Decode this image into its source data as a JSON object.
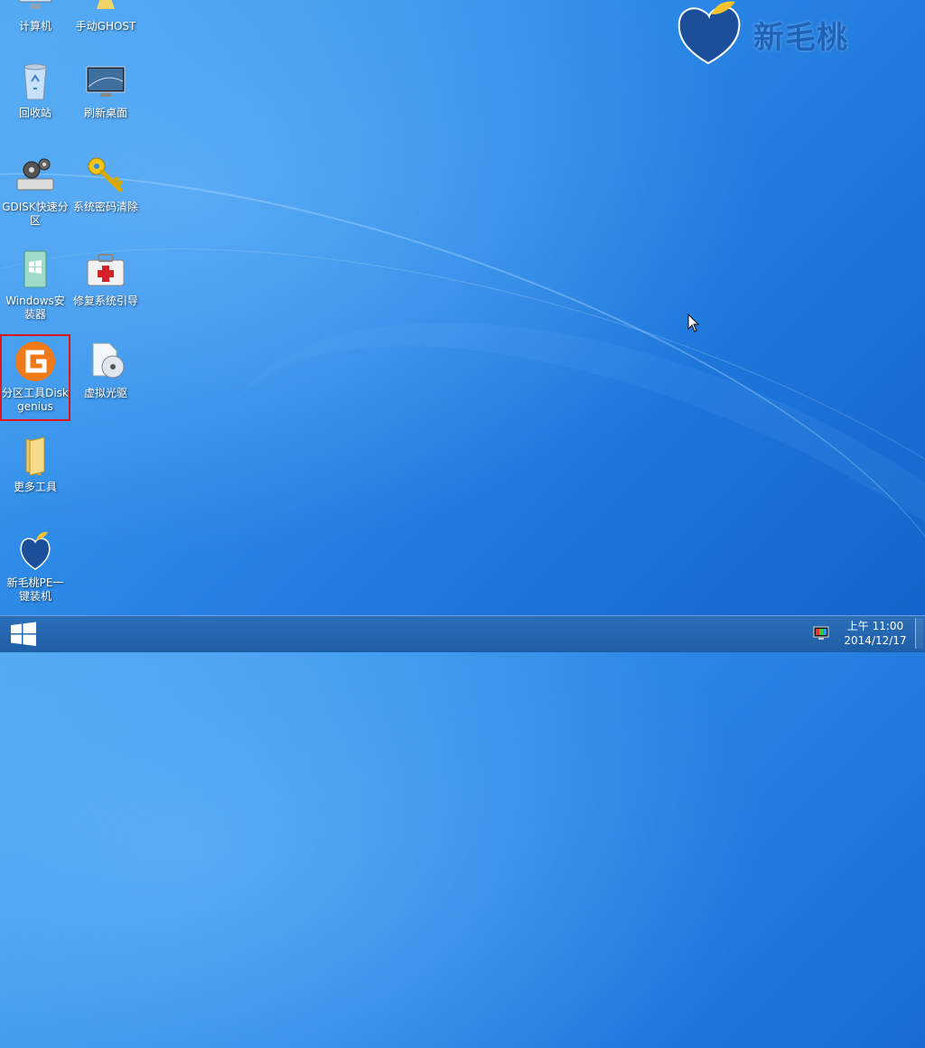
{
  "brand": {
    "name": "新毛桃"
  },
  "desktop": {
    "icons": [
      {
        "label": "计算机"
      },
      {
        "label": "手动GHOST"
      },
      {
        "label": "回收站"
      },
      {
        "label": "刷新桌面"
      },
      {
        "label": "GDISK快速分区"
      },
      {
        "label": "系统密码清除"
      },
      {
        "label": "Windows安装器"
      },
      {
        "label": "修复系统引导"
      },
      {
        "label": "分区工具Diskgenius",
        "selected": true
      },
      {
        "label": "虚拟光驱"
      },
      {
        "label": "更多工具"
      },
      {
        "label": "新毛桃PE一键装机"
      }
    ]
  },
  "taskbar": {
    "clock_time": "上午 11:00",
    "clock_date": "2014/12/17"
  },
  "colors": {
    "highlight": "#e0151c",
    "brand": "#1e63b8"
  }
}
